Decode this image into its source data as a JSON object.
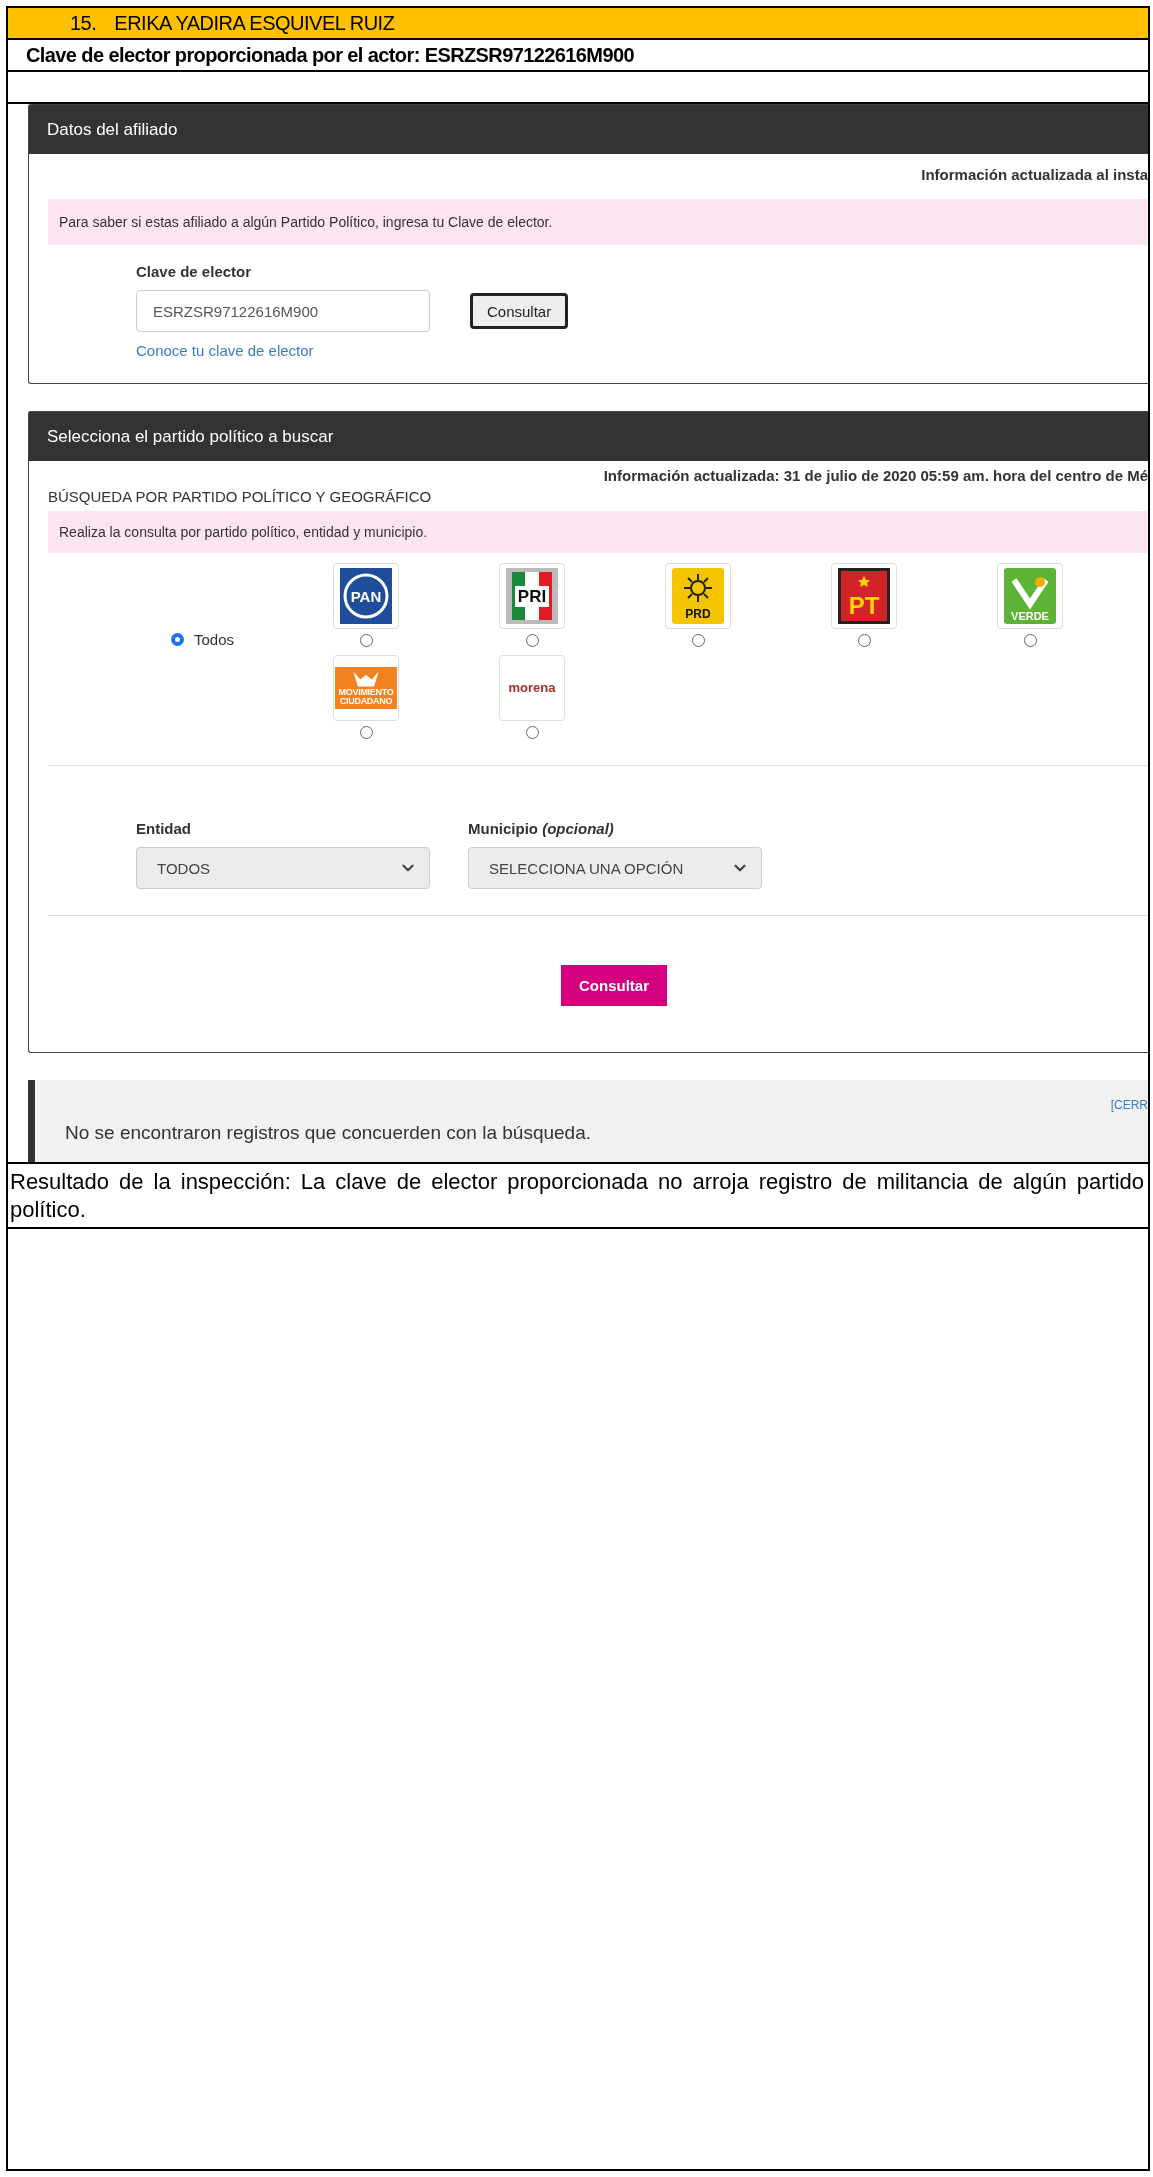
{
  "document": {
    "heading_number": "15.",
    "heading_name": "ERIKA YADIRA ESQUIVEL RUIZ",
    "clave_line": "Clave de elector proporcionada por el actor: ESRZSR97122616M900",
    "result": "Resultado de la inspección: La clave de elector proporcionada no arroja registro de militancia de algún partido político."
  },
  "screenshot": {
    "affiliate_panel": {
      "title": "Datos del afiliado",
      "updated": "Información actualizada al insta",
      "notice": "Para saber si estas afiliado a algún Partido Político, ingresa tu Clave de elector.",
      "field_label": "Clave de elector",
      "field_value": "ESRZSR97122616M900",
      "button": "Consultar",
      "link": "Conoce tu clave de elector"
    },
    "party_panel": {
      "title": "Selecciona el partido político a buscar",
      "updated": "Información actualizada: 31 de julio de 2020 05:59 am. hora del centro de Mé",
      "section_title": "BÚSQUEDA POR PARTIDO POLÍTICO Y GEOGRÁFICO",
      "notice": "Realiza la consulta por partido político, entidad y municipio.",
      "all_option": {
        "label": "Todos",
        "selected": true
      },
      "parties": [
        {
          "kind": "pan",
          "label": "PAN",
          "selected": false
        },
        {
          "kind": "pri",
          "label": "PRI",
          "selected": false
        },
        {
          "kind": "prd",
          "label": "PRD",
          "selected": false
        },
        {
          "kind": "pt",
          "label": "PT",
          "selected": false
        },
        {
          "kind": "verde",
          "label": "VERDE",
          "selected": false
        },
        {
          "kind": "mc",
          "label": "MOVIMIENTO CIUDADANO",
          "selected": false
        },
        {
          "kind": "morena",
          "label": "morena",
          "selected": false
        }
      ],
      "entity": {
        "label": "Entidad",
        "value": "TODOS"
      },
      "municipality": {
        "label": "Municipio *(opcional)*",
        "value": "SELECCIONA UNA OPCIÓN"
      },
      "button": "Consultar"
    },
    "message": {
      "text": "No se encontraron registros que concuerden con la búsqueda.",
      "close": "[CERR"
    }
  }
}
